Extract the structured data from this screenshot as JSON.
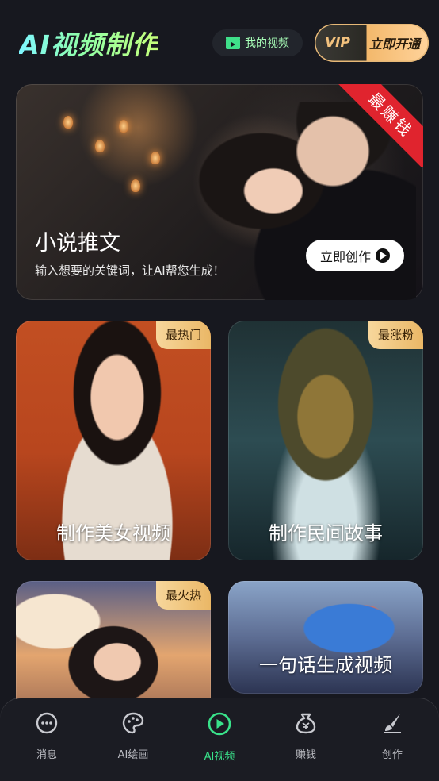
{
  "header": {
    "title": "AI视频制作",
    "my_video_label": "我的视频",
    "vip_tag": "VIP",
    "vip_label": "立即开通"
  },
  "hero": {
    "ribbon": "最赚钱",
    "title": "小说推文",
    "subtitle": "输入想要的关键词，让AI帮您生成！",
    "button_label": "立即创作"
  },
  "cards": [
    {
      "title": "制作美女视频",
      "badge": "最热门"
    },
    {
      "title": "制作民间故事",
      "badge": "最涨粉"
    },
    {
      "title": "",
      "badge": "最火热"
    },
    {
      "title": "一句话生成视频",
      "badge": ""
    }
  ],
  "tabs": [
    {
      "label": "消息",
      "icon": "message-icon"
    },
    {
      "label": "AI绘画",
      "icon": "palette-icon"
    },
    {
      "label": "AI视频",
      "icon": "play-icon",
      "active": true
    },
    {
      "label": "赚钱",
      "icon": "money-bag-icon"
    },
    {
      "label": "创作",
      "icon": "brush-icon"
    }
  ],
  "colors": {
    "background": "#17181f",
    "accent_green": "#39e28a",
    "ribbon_red": "#e0242e",
    "badge_gold": "#eab766"
  }
}
